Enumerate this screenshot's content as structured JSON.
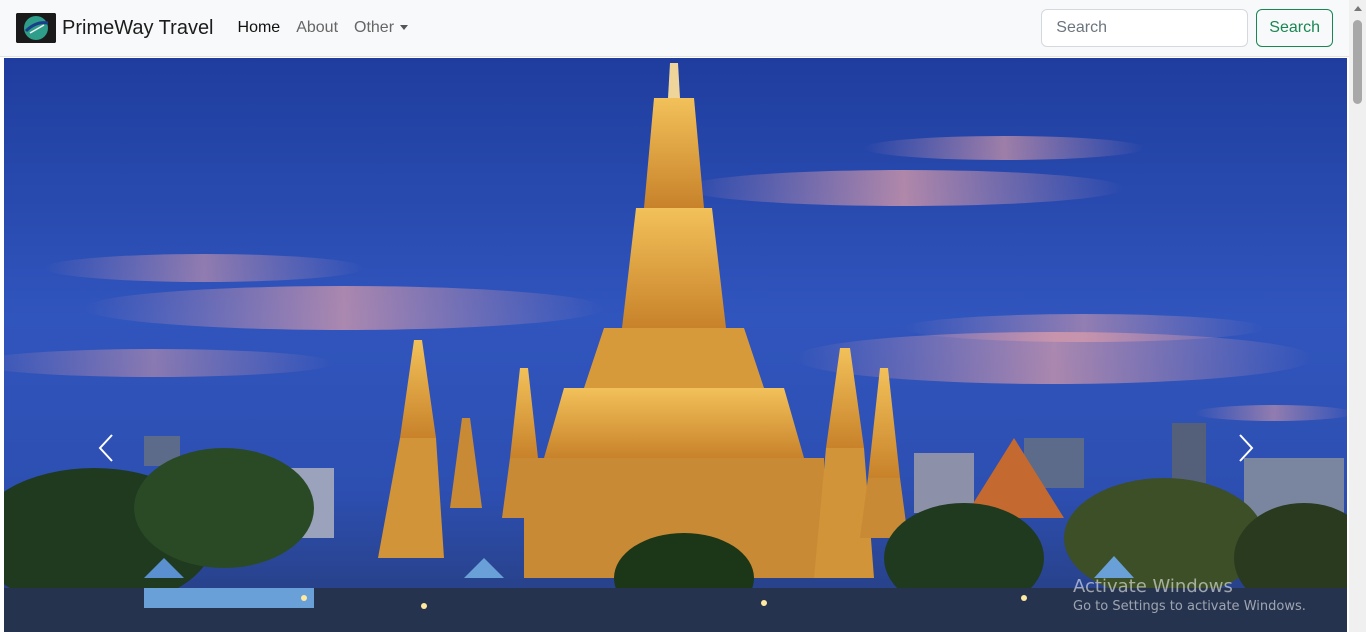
{
  "navbar": {
    "brand": "PrimeWay Travel",
    "links": [
      {
        "label": "Home",
        "active": true
      },
      {
        "label": "About",
        "active": false
      },
      {
        "label": "Other",
        "active": false
      }
    ],
    "search": {
      "placeholder": "Search",
      "value": "",
      "button_label": "Search"
    }
  },
  "colors": {
    "navbar_bg": "#f8f9fa",
    "search_button": "#198754",
    "sky": "#2a4cb0",
    "temple_gold": "#e0a53c"
  },
  "carousel": {
    "prev_icon": "chevron-left-icon",
    "next_icon": "chevron-right-icon"
  },
  "watermark": {
    "title": "Activate Windows",
    "subtitle": "Go to Settings to activate Windows."
  }
}
